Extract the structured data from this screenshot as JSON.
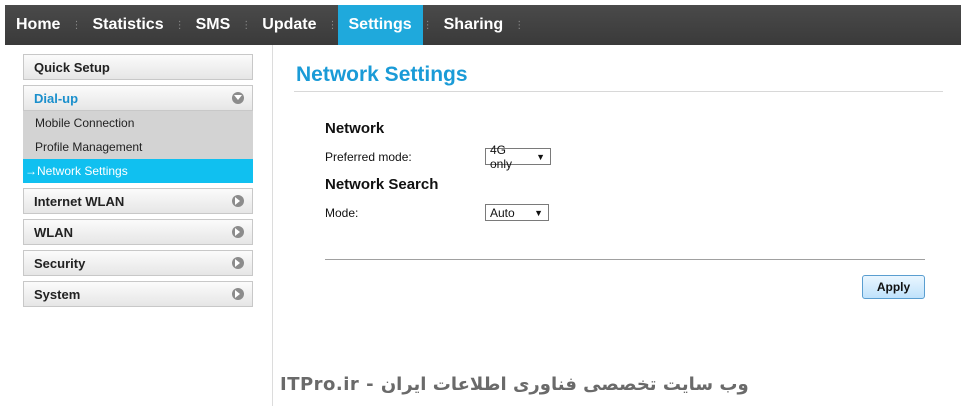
{
  "nav": {
    "items": [
      {
        "label": "Home",
        "active": false
      },
      {
        "label": "Statistics",
        "active": false
      },
      {
        "label": "SMS",
        "active": false
      },
      {
        "label": "Update",
        "active": false
      },
      {
        "label": "Settings",
        "active": true
      },
      {
        "label": "Sharing",
        "active": false
      }
    ],
    "active_color": "#1fa9dc"
  },
  "sidebar": {
    "quick_setup": "Quick Setup",
    "dialup": {
      "label": "Dial-up",
      "items": [
        {
          "label": "Mobile Connection",
          "active": false
        },
        {
          "label": "Profile Management",
          "active": false
        },
        {
          "label": "→Network Settings",
          "active": true
        }
      ]
    },
    "menus": [
      {
        "label": "Internet WLAN"
      },
      {
        "label": "WLAN"
      },
      {
        "label": "Security"
      },
      {
        "label": "System"
      }
    ]
  },
  "main": {
    "title": "Network Settings",
    "network": {
      "heading": "Network",
      "preferred_mode_label": "Preferred mode:",
      "preferred_mode_value": "4G only"
    },
    "network_search": {
      "heading": "Network Search",
      "mode_label": "Mode:",
      "mode_value": "Auto"
    },
    "apply_label": "Apply"
  },
  "watermark": "ITPro.ir - وب سایت تخصصی فناوری اطلاعات ایران",
  "colors": {
    "accent": "#1a9bd7",
    "highlight": "#10c0f0"
  }
}
